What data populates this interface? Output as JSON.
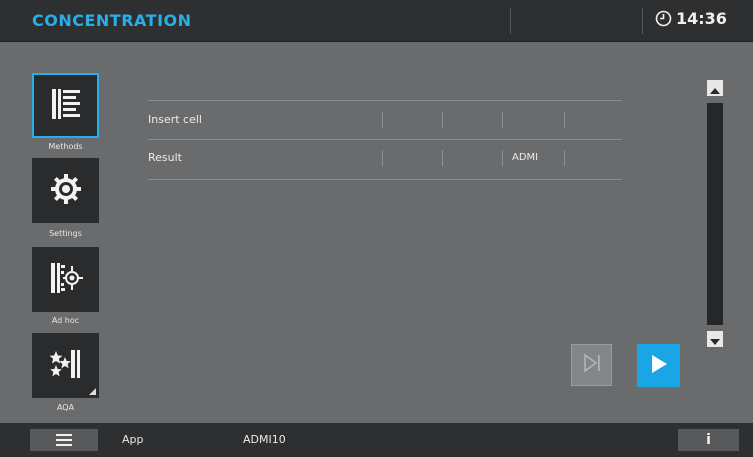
{
  "header": {
    "title": "CONCENTRATION",
    "time": "14:36",
    "clock_icon": "clock-icon"
  },
  "sidebar": {
    "items": [
      {
        "label": "Methods",
        "icon": "methods-list-icon",
        "selected": true
      },
      {
        "label": "Settings",
        "icon": "gear-icon",
        "selected": false
      },
      {
        "label": "Ad hoc",
        "icon": "ad-hoc-icon",
        "selected": false
      },
      {
        "label": "AQA",
        "icon": "aqa-stars-icon",
        "selected": false
      }
    ]
  },
  "table": {
    "rows": [
      {
        "label": "Insert cell",
        "cells": [
          "",
          "",
          "",
          ""
        ]
      },
      {
        "label": "Result",
        "cells": [
          "",
          "",
          "ADMI",
          ""
        ]
      }
    ]
  },
  "actions": {
    "skip_icon": "skip-to-end-icon",
    "start_icon": "play-icon"
  },
  "footer": {
    "menu_icon": "hamburger-menu-icon",
    "app_label": "App",
    "app_value": "ADMI10",
    "info_label": "i"
  },
  "colors": {
    "accent": "#29aee8",
    "background": "#6a6b6d",
    "bar": "#2e2f31",
    "tile": "#2a2b2d"
  }
}
